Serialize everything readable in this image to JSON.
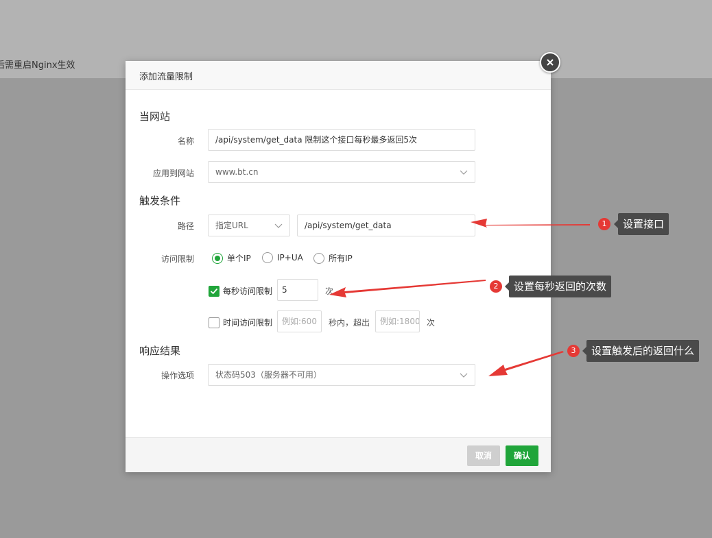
{
  "background": {
    "hint_text": "后需重启Nginx生效"
  },
  "dialog": {
    "title": "添加流量限制",
    "sections": {
      "site": "当网站",
      "trigger": "触发条件",
      "response": "响应结果"
    },
    "name": {
      "label": "名称",
      "value": "/api/system/get_data 限制这个接口每秒最多返回5次"
    },
    "apply_site": {
      "label": "应用到网站",
      "value": "www.bt.cn"
    },
    "path": {
      "label": "路径",
      "type_value": "指定URL",
      "value": "/api/system/get_data"
    },
    "access_limit": {
      "label": "访问限制",
      "options": [
        "单个IP",
        "IP+UA",
        "所有IP"
      ],
      "selected": "单个IP"
    },
    "per_second": {
      "label": "每秒访问限制",
      "checked": true,
      "value": "5",
      "unit": "次"
    },
    "time_limit": {
      "label": "时间访问限制",
      "checked": false,
      "seconds_placeholder": "例如:600",
      "middle_text": "秒内，超出",
      "count_placeholder": "例如:1800",
      "unit": "次"
    },
    "action": {
      "label": "操作选项",
      "value": "状态码503（服务器不可用）"
    },
    "buttons": {
      "cancel": "取消",
      "confirm": "确认"
    }
  },
  "annotations": [
    {
      "number": "1",
      "text": "设置接口"
    },
    {
      "number": "2",
      "text": "设置每秒返回的次数"
    },
    {
      "number": "3",
      "text": "设置触发后的返回什么"
    }
  ],
  "colors": {
    "accent": "#20a53a",
    "annotation": "#e53935",
    "tooltip": "#4a4a4a"
  }
}
